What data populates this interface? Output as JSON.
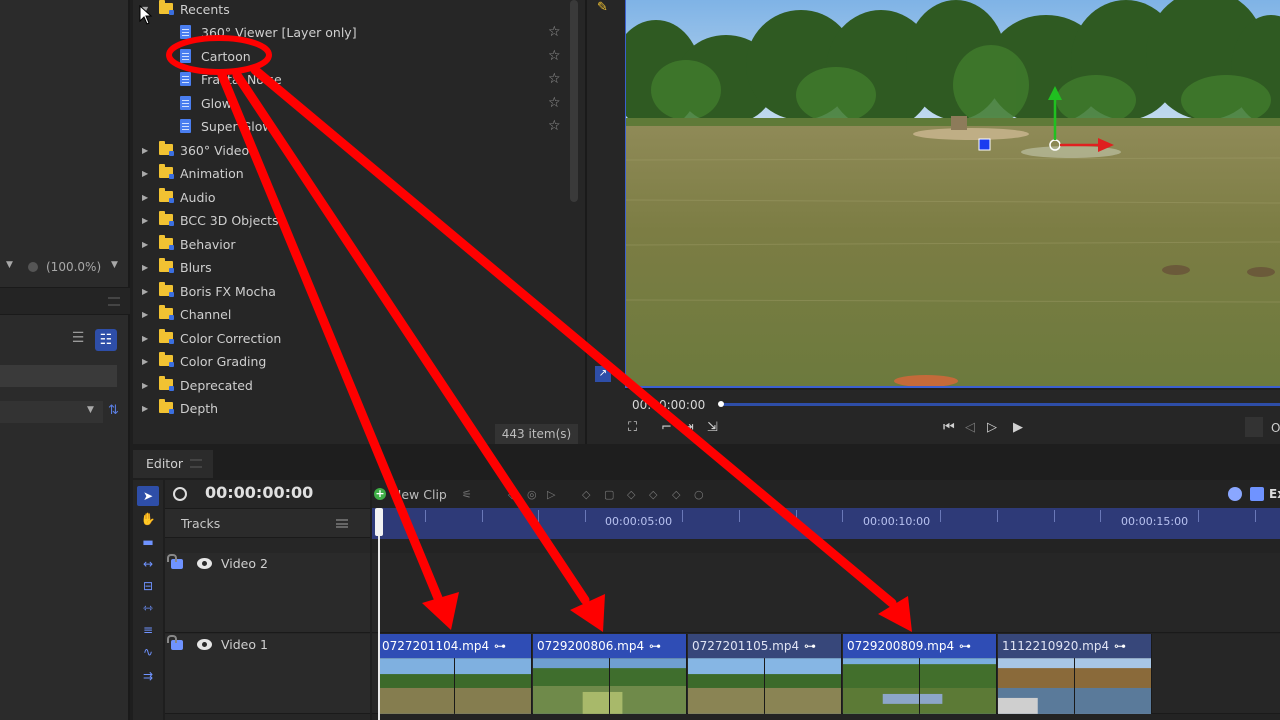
{
  "left_panel": {
    "zoom_value": "(100.0%)"
  },
  "effects_library": {
    "recents_label": "Recents",
    "recents_items": [
      {
        "label": "360° Viewer [Layer only]"
      },
      {
        "label": "Cartoon"
      },
      {
        "label": "Fractal Noise"
      },
      {
        "label": "Glow"
      },
      {
        "label": "Super Glow"
      }
    ],
    "categories": [
      {
        "label": "360° Video"
      },
      {
        "label": "Animation"
      },
      {
        "label": "Audio"
      },
      {
        "label": "BCC 3D Objects"
      },
      {
        "label": "Behavior"
      },
      {
        "label": "Blurs"
      },
      {
        "label": "Boris FX Mocha"
      },
      {
        "label": "Channel"
      },
      {
        "label": "Color Correction"
      },
      {
        "label": "Color Grading"
      },
      {
        "label": "Deprecated"
      },
      {
        "label": "Depth"
      }
    ],
    "item_count": "443 item(s)"
  },
  "viewer": {
    "timecode": "00:00:00:00",
    "o_label": "O"
  },
  "editor": {
    "tab_label": "Editor",
    "timecode": "00:00:00:00",
    "tracks_label": "Tracks",
    "new_clip_label": "New Clip",
    "export_label": "Ex",
    "ruler_labels": [
      "00:00:05:00",
      "00:00:10:00",
      "00:00:15:00"
    ],
    "tracks": [
      {
        "name": "Video 2"
      },
      {
        "name": "Video 1"
      }
    ],
    "clips": [
      {
        "name": "0727201104.mp4",
        "selected": true
      },
      {
        "name": "0729200806.mp4",
        "selected": true
      },
      {
        "name": "0727201105.mp4",
        "selected": false
      },
      {
        "name": "0729200809.mp4",
        "selected": true
      },
      {
        "name": "1112210920.mp4",
        "selected": false
      }
    ]
  },
  "colors": {
    "accent_blue": "#2e4ea8",
    "annotation_red": "#ff0000",
    "folder_yellow": "#f1c232",
    "ruler_blue": "#2e3a78"
  }
}
